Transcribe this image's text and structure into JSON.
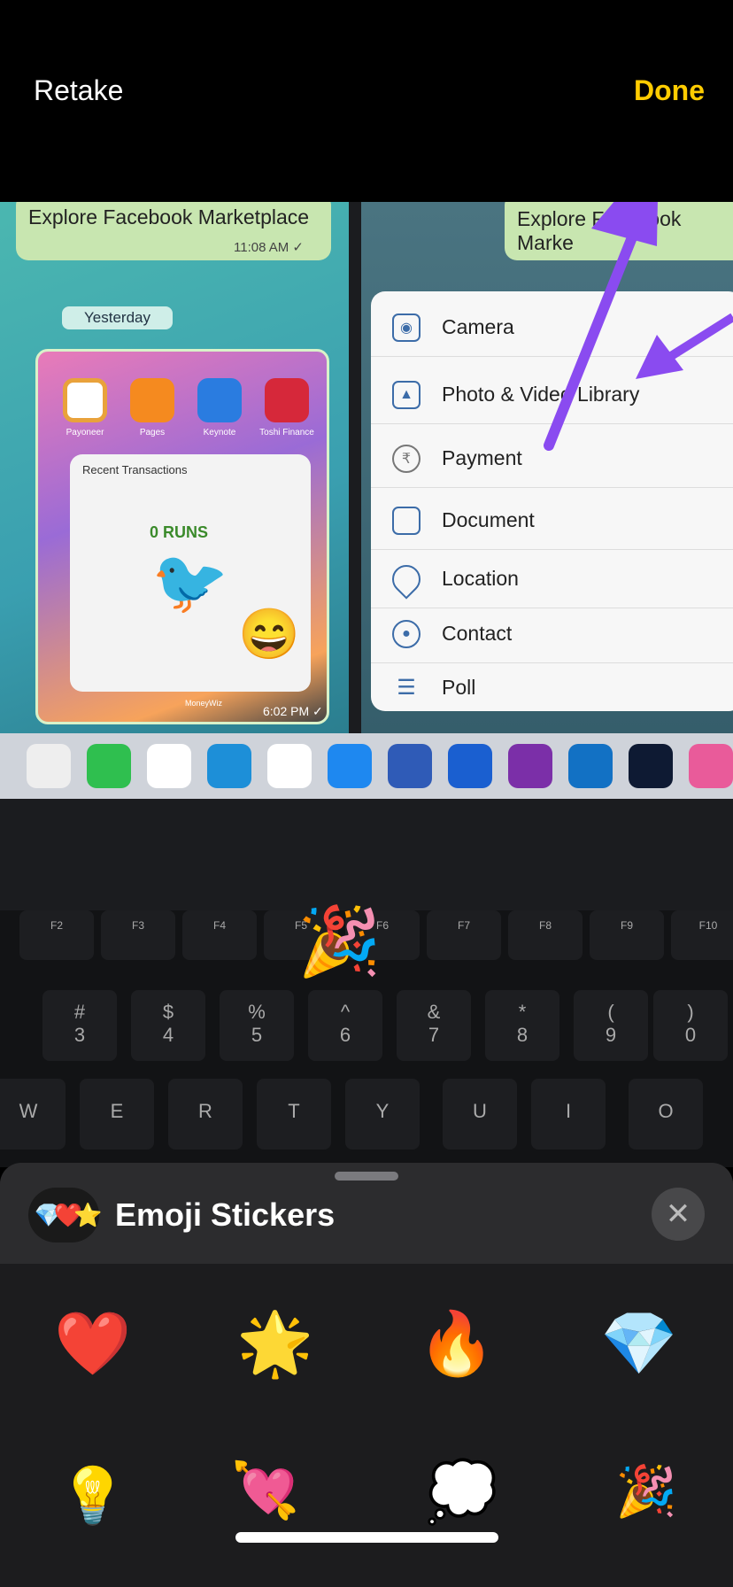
{
  "topbar": {
    "retake": "Retake",
    "done": "Done",
    "done_color": "#ffcc00"
  },
  "photo": {
    "left_chat": {
      "message": "Explore Facebook Marketplace",
      "time": "11:08 AM ✓",
      "date_chip": "Yesterday",
      "apps": [
        "Payoneer",
        "Pages",
        "Keynote",
        "Toshi Finance"
      ],
      "widget_title": "Recent Transactions",
      "widget_footer": "MoneyWiz",
      "runs_label": "0 RUNS",
      "time2": "6:02 PM ✓"
    },
    "right_chat": {
      "message": "Explore Facebook Marke"
    },
    "attach_menu": [
      {
        "icon": "camera-icon",
        "label": "Camera"
      },
      {
        "icon": "photo-icon",
        "label": "Photo & Video Library"
      },
      {
        "icon": "rupee-icon",
        "label": "Payment"
      },
      {
        "icon": "document-icon",
        "label": "Document"
      },
      {
        "icon": "location-icon",
        "label": "Location"
      },
      {
        "icon": "contact-icon",
        "label": "Contact"
      },
      {
        "icon": "poll-icon",
        "label": "Poll"
      }
    ],
    "fkeys": [
      "F2",
      "F3",
      "F4",
      "F5",
      "F6",
      "F7",
      "F8",
      "F9",
      "F10"
    ],
    "num_keys": [
      [
        "#",
        "3"
      ],
      [
        "$",
        "4"
      ],
      [
        "%",
        "5"
      ],
      [
        "^",
        "6"
      ],
      [
        "&",
        "7"
      ],
      [
        "*",
        "8"
      ],
      [
        "(",
        "9"
      ],
      [
        ")",
        "0"
      ]
    ],
    "letter_keys": [
      "W",
      "E",
      "R",
      "T",
      "Y",
      "U",
      "I",
      "O"
    ],
    "placed_sticker": "🎉",
    "arrow_color": "#8a4bf0"
  },
  "sheet": {
    "icon": "💎❤️⭐",
    "title": "Emoji Stickers",
    "close": "✕",
    "stickers": [
      {
        "name": "red-heart",
        "emoji": "❤️"
      },
      {
        "name": "glowing-star",
        "emoji": "🌟"
      },
      {
        "name": "fire",
        "emoji": "🔥"
      },
      {
        "name": "gem",
        "emoji": "💎"
      },
      {
        "name": "light-bulb",
        "emoji": "💡"
      },
      {
        "name": "heart-with-arrow",
        "emoji": "💘"
      },
      {
        "name": "thought-balloon",
        "emoji": "💭"
      },
      {
        "name": "party-popper",
        "emoji": "🎉"
      }
    ]
  }
}
